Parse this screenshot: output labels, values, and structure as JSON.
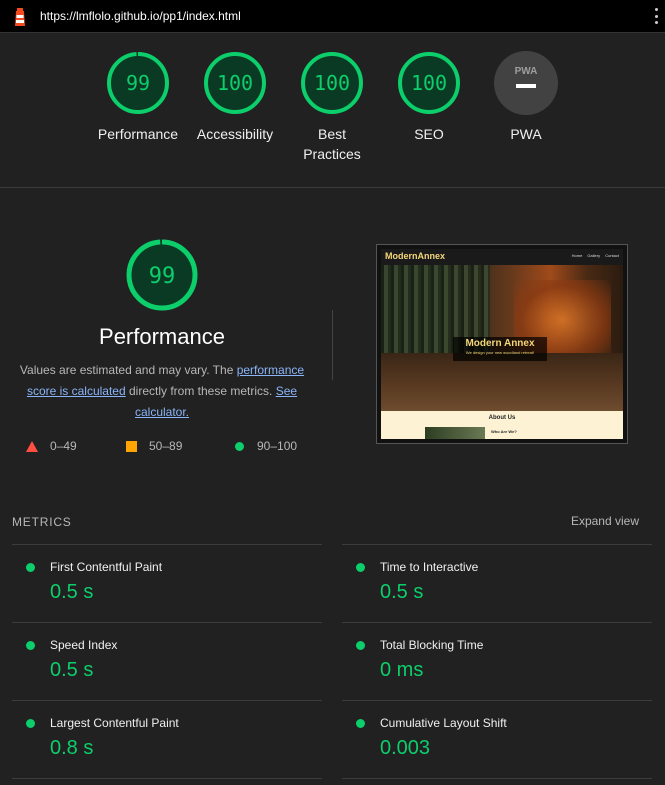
{
  "topbar": {
    "url": "https://lmflolo.github.io/pp1/index.html",
    "logo_icon": "lighthouse-icon",
    "menu_icon": "kebab-menu-icon"
  },
  "colors": {
    "pass": "#0cce6b",
    "average": "#ffa400",
    "fail": "#ff4e42",
    "na": "#9e9e9e"
  },
  "categories": [
    {
      "score": "99",
      "label": "Performance"
    },
    {
      "score": "100",
      "label": "Accessibility"
    },
    {
      "score": "100",
      "label": "Best Practices"
    },
    {
      "score": "100",
      "label": "SEO"
    },
    {
      "score": "PWA",
      "label": "PWA"
    }
  ],
  "performance": {
    "score": "99",
    "title": "Performance",
    "desc_before": "Values are estimated and may vary. The ",
    "desc_link1": "performance score is calculated",
    "desc_middle": " directly from these metrics. ",
    "desc_link2": "See calculator.",
    "legend": [
      {
        "icon": "triangle-icon",
        "range": "0–49"
      },
      {
        "icon": "square-icon",
        "range": "50–89"
      },
      {
        "icon": "circle-icon",
        "range": "90–100"
      }
    ]
  },
  "thumbnail": {
    "brand": "ModernAnnex",
    "nav_links": "Home Gallery Contact",
    "hero_title": "Modern Annex",
    "hero_sub": "We design your new woodland retreat!",
    "about": "About Us",
    "who": "Who Are We?"
  },
  "metrics": {
    "heading": "METRICS",
    "expand": "Expand view",
    "items": [
      {
        "name": "First Contentful Paint",
        "value": "0.5 s"
      },
      {
        "name": "Time to Interactive",
        "value": "0.5 s"
      },
      {
        "name": "Speed Index",
        "value": "0.5 s"
      },
      {
        "name": "Total Blocking Time",
        "value": "0 ms"
      },
      {
        "name": "Largest Contentful Paint",
        "value": "0.8 s"
      },
      {
        "name": "Cumulative Layout Shift",
        "value": "0.003"
      }
    ]
  }
}
